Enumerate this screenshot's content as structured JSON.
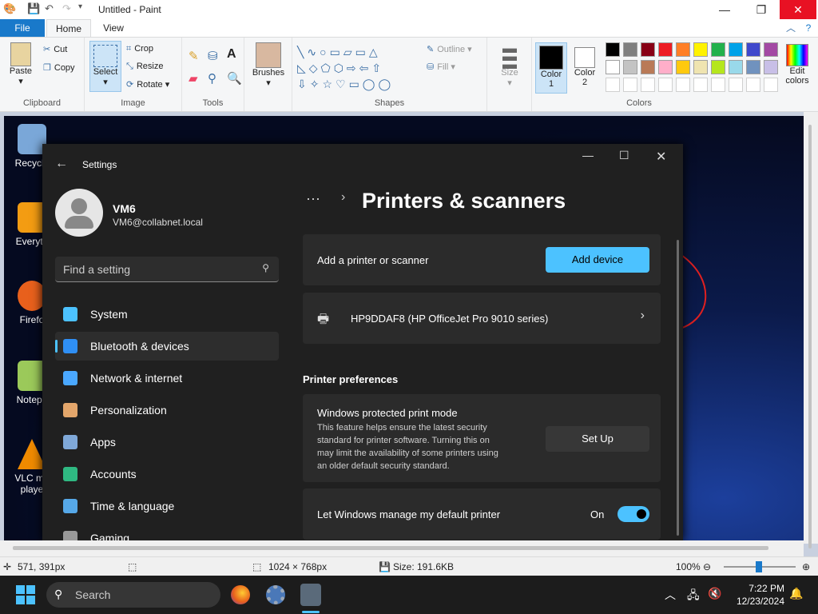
{
  "paint": {
    "title": "Untitled - Paint",
    "tabs": [
      "File",
      "Home",
      "View"
    ],
    "clipboard": {
      "paste": "Paste",
      "cut": "Cut",
      "copy": "Copy",
      "label": "Clipboard"
    },
    "image": {
      "select": "Select",
      "crop": "Crop",
      "resize": "Resize",
      "rotate": "Rotate",
      "label": "Image"
    },
    "tools_label": "Tools",
    "brushes": "Brushes",
    "shapes": {
      "outline": "Outline",
      "fill": "Fill",
      "label": "Shapes"
    },
    "size": "Size",
    "color1": [
      "Color",
      "1"
    ],
    "color2": [
      "Color",
      "2"
    ],
    "edit_colors": [
      "Edit",
      "colors"
    ],
    "colors_label": "Colors",
    "palette_row1": [
      "#000000",
      "#7f7f7f",
      "#880015",
      "#ed1c24",
      "#ff7f27",
      "#fff200",
      "#22b14c",
      "#00a2e8",
      "#3f48cc",
      "#a349a4"
    ],
    "palette_row2": [
      "#ffffff",
      "#c3c3c3",
      "#b97a57",
      "#ffaec9",
      "#ffc90e",
      "#efe4b0",
      "#b5e61d",
      "#99d9ea",
      "#7092be",
      "#c8bfe7"
    ]
  },
  "status": {
    "coords": "571, 391px",
    "dimensions": "1024 × 768px",
    "size": "Size: 191.6KB",
    "zoom": "100%"
  },
  "desktop_icons": [
    {
      "label": "Recycle",
      "color": "#7aa7d8"
    },
    {
      "label": "Everyth",
      "color": "#f39c12"
    },
    {
      "label": "Firefo",
      "color": "#e8601c"
    },
    {
      "label": "Notepa",
      "color": "#9bc95a"
    },
    {
      "label": "VLC me",
      "label2": "playe",
      "color": "#f08a00"
    }
  ],
  "settings": {
    "title": "Settings",
    "user": {
      "name": "VM6",
      "email": "VM6@collabnet.local"
    },
    "search_placeholder": "Find a setting",
    "breadcrumb_more": "···",
    "page_title": "Printers & scanners",
    "nav": [
      {
        "label": "System",
        "color": "#4cc2ff"
      },
      {
        "label": "Bluetooth & devices",
        "color": "#2f8ff5"
      },
      {
        "label": "Network & internet",
        "color": "#4aa8ff"
      },
      {
        "label": "Personalization",
        "color": "#e3a66b"
      },
      {
        "label": "Apps",
        "color": "#7fa8d8"
      },
      {
        "label": "Accounts",
        "color": "#2fb982"
      },
      {
        "label": "Time & language",
        "color": "#56a8e8"
      },
      {
        "label": "Gaming",
        "color": "#999999"
      }
    ],
    "add_printer": {
      "label": "Add a printer or scanner",
      "button": "Add device"
    },
    "printer": {
      "name": "HP9DDAF8 (HP OfficeJet Pro 9010 series)"
    },
    "prefs_heading": "Printer preferences",
    "protected": {
      "title": "Windows protected print mode",
      "desc": [
        "This feature helps ensure the latest security",
        "standard for printer software. Turning this on",
        "may limit the availability of some printers using",
        "an older default security standard."
      ],
      "button": "Set Up"
    },
    "default_printer": {
      "label": "Let Windows manage my default printer",
      "state": "On"
    },
    "accent": "#4cc2ff"
  },
  "taskbar": {
    "search": "Search",
    "time": "7:22 PM",
    "date": "12/23/2024"
  }
}
